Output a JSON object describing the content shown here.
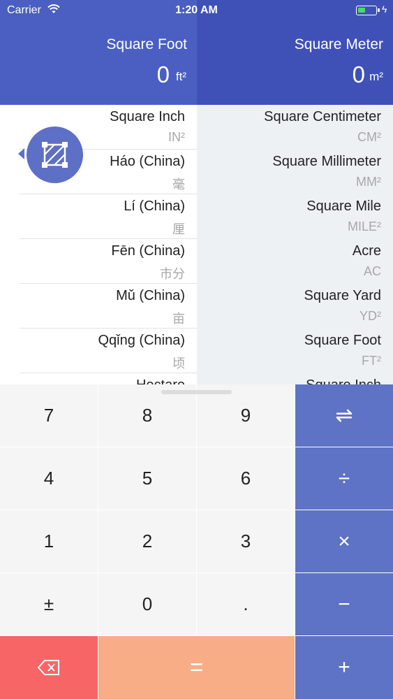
{
  "status_bar": {
    "carrier": "Carrier",
    "time": "1:20 AM",
    "battery_color": "#4cd964"
  },
  "header": {
    "left": {
      "title": "Square Foot",
      "value": "0",
      "symbol": "ft²"
    },
    "right": {
      "title": "Square Meter",
      "value": "0",
      "symbol": "m²"
    }
  },
  "badge": {
    "icon": "area-icon"
  },
  "left_list": [
    {
      "name": "Square Inch",
      "abbr": "IN²"
    },
    {
      "name": "Háo (China)",
      "abbr": "毫"
    },
    {
      "name": "Lí (China)",
      "abbr": "厘"
    },
    {
      "name": "Fēn (China)",
      "abbr": "市分"
    },
    {
      "name": "Mǔ (China)",
      "abbr": "亩"
    },
    {
      "name": "Qqǐng (China)",
      "abbr": "顷"
    },
    {
      "name": "Hectare",
      "abbr": ""
    }
  ],
  "right_list": [
    {
      "name": "Square Centimeter",
      "abbr": "CM²"
    },
    {
      "name": "Square Millimeter",
      "abbr": "MM²"
    },
    {
      "name": "Square Mile",
      "abbr": "MILE²"
    },
    {
      "name": "Acre",
      "abbr": "AC"
    },
    {
      "name": "Square Yard",
      "abbr": "YD²"
    },
    {
      "name": "Square Foot",
      "abbr": "FT²"
    },
    {
      "name": "Square Inch",
      "abbr": ""
    }
  ],
  "keypad": {
    "k7": "7",
    "k8": "8",
    "k9": "9",
    "swap": "⇌",
    "k4": "4",
    "k5": "5",
    "k6": "6",
    "divide": "÷",
    "k1": "1",
    "k2": "2",
    "k3": "3",
    "multiply": "×",
    "plusminus": "±",
    "k0": "0",
    "dot": ".",
    "minus": "−",
    "equals": "=",
    "plus": "+"
  },
  "colors": {
    "header_left": "#4a5fc1",
    "header_right": "#3f51b7",
    "operator": "#5e72c6",
    "delete": "#f86567",
    "equals": "#f9ad86"
  }
}
